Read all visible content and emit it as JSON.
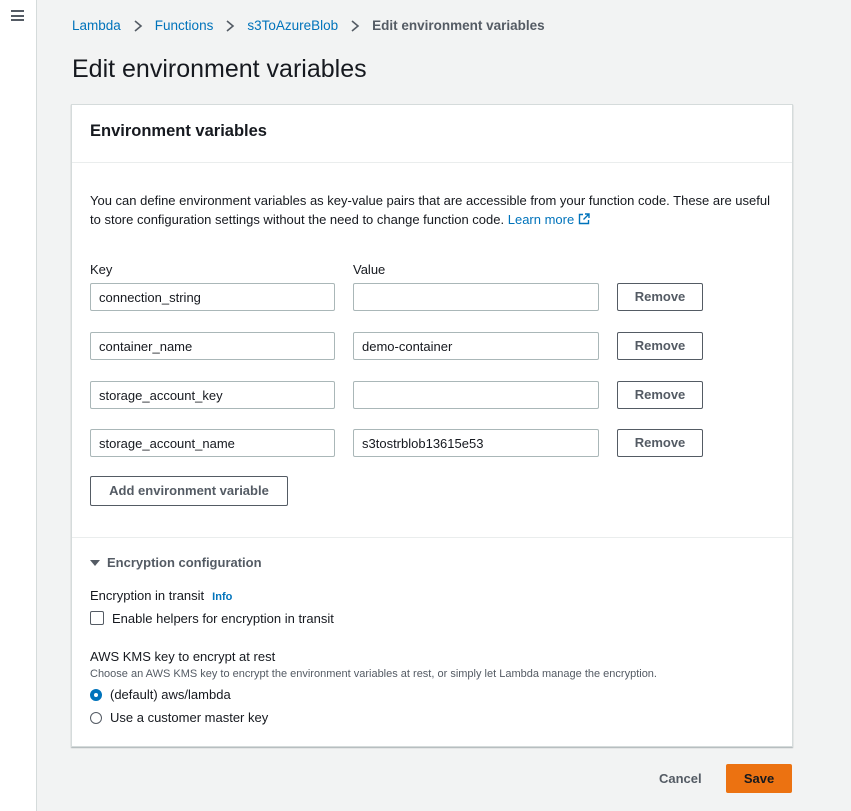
{
  "breadcrumb": {
    "items": [
      "Lambda",
      "Functions",
      "s3ToAzureBlob"
    ],
    "current": "Edit environment variables"
  },
  "page_title": "Edit environment variables",
  "panel": {
    "title": "Environment variables",
    "description": "You can define environment variables as key-value pairs that are accessible from your function code. These are useful to store configuration settings without the need to change function code.",
    "learn_more": "Learn more",
    "key_label": "Key",
    "value_label": "Value",
    "variables": [
      {
        "key": "connection_string",
        "value": ""
      },
      {
        "key": "container_name",
        "value": "demo-container"
      },
      {
        "key": "storage_account_key",
        "value": ""
      },
      {
        "key": "storage_account_name",
        "value": "s3tostrblob13615e53"
      }
    ],
    "remove_label": "Remove",
    "add_label": "Add environment variable"
  },
  "encryption": {
    "toggle_label": "Encryption configuration",
    "transit_label": "Encryption in transit",
    "info": "Info",
    "helpers_label": "Enable helpers for encryption in transit",
    "helpers_checked": false,
    "kms_label": "AWS KMS key to encrypt at rest",
    "kms_desc": "Choose an AWS KMS key to encrypt the environment variables at rest, or simply let Lambda manage the encryption.",
    "options": [
      {
        "label": "(default) aws/lambda",
        "selected": true
      },
      {
        "label": "Use a customer master key",
        "selected": false
      }
    ]
  },
  "footer": {
    "cancel": "Cancel",
    "save": "Save"
  },
  "colors": {
    "link": "#0073bb",
    "primary_button": "#ec7211",
    "background": "#f2f3f3"
  },
  "icons": {
    "menu": "hamburger-menu-icon",
    "separator": "chevron-right-icon",
    "external": "external-link-icon",
    "caret": "caret-down-icon"
  }
}
